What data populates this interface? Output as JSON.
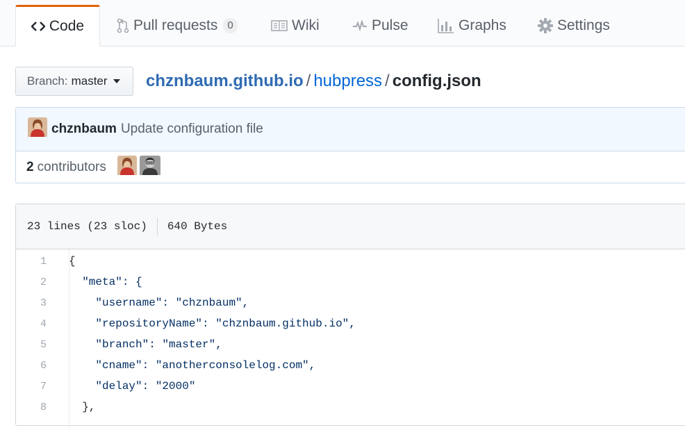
{
  "tabs": [
    {
      "label": "Code",
      "icon": "code-icon",
      "selected": true
    },
    {
      "label": "Pull requests",
      "icon": "pull-request-icon",
      "count": "0"
    },
    {
      "label": "Wiki",
      "icon": "book-icon"
    },
    {
      "label": "Pulse",
      "icon": "pulse-icon"
    },
    {
      "label": "Graphs",
      "icon": "graph-icon"
    },
    {
      "label": "Settings",
      "icon": "gear-icon"
    }
  ],
  "branch": {
    "label": "Branch:",
    "value": "master"
  },
  "breadcrumb": {
    "root": "chznbaum.github.io",
    "separator": "/",
    "folder": "hubpress",
    "file": "config.json"
  },
  "commit": {
    "author": "chznbaum",
    "message": "Update configuration file"
  },
  "contributors": {
    "count": "2",
    "label": "contributors"
  },
  "file": {
    "lines": "23 lines (23 sloc)",
    "size": "640 Bytes"
  },
  "code_lines": [
    {
      "n": "1",
      "text": "{"
    },
    {
      "n": "2",
      "text": "  \"meta\": {"
    },
    {
      "n": "3",
      "text": "    \"username\": \"chznbaum\","
    },
    {
      "n": "4",
      "text": "    \"repositoryName\": \"chznbaum.github.io\","
    },
    {
      "n": "5",
      "text": "    \"branch\": \"master\","
    },
    {
      "n": "6",
      "text": "    \"cname\": \"anotherconsolelog.com\","
    },
    {
      "n": "7",
      "text": "    \"delay\": \"2000\""
    },
    {
      "n": "8",
      "text": "  },"
    }
  ],
  "colors": {
    "accent": "#e36209",
    "link": "#0366d6",
    "string": "#032f62"
  }
}
